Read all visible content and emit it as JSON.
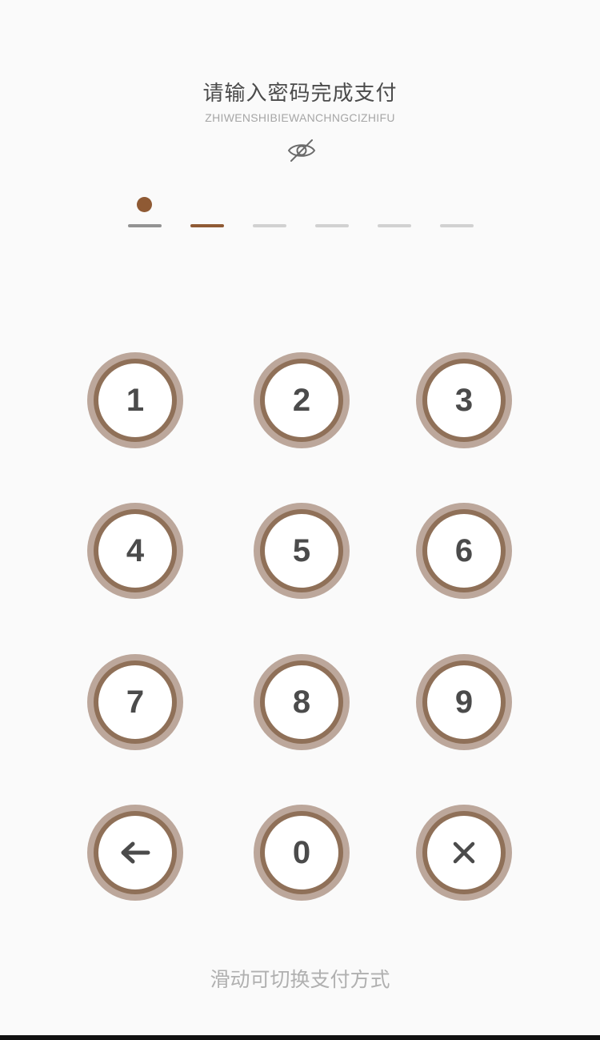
{
  "header": {
    "title": "请输入密码完成支付",
    "subtitle": "ZHIWENSHIBIEWANCHNGCIZHIFU",
    "visibility_icon": "eye-off-icon"
  },
  "pin": {
    "length": 6,
    "entered": 1,
    "active_index": 1
  },
  "keypad": {
    "keys": [
      {
        "label": "1"
      },
      {
        "label": "2"
      },
      {
        "label": "3"
      },
      {
        "label": "4"
      },
      {
        "label": "5"
      },
      {
        "label": "6"
      },
      {
        "label": "7"
      },
      {
        "label": "8"
      },
      {
        "label": "9"
      },
      {
        "icon": "arrow-left-icon"
      },
      {
        "label": "0"
      },
      {
        "icon": "close-icon"
      }
    ]
  },
  "footer": {
    "hint": "滑动可切换支付方式"
  },
  "colors": {
    "accent": "#8f5a34",
    "key_outer": "#bca79b",
    "key_ring": "#8f7058",
    "text": "#4b4b4b"
  }
}
